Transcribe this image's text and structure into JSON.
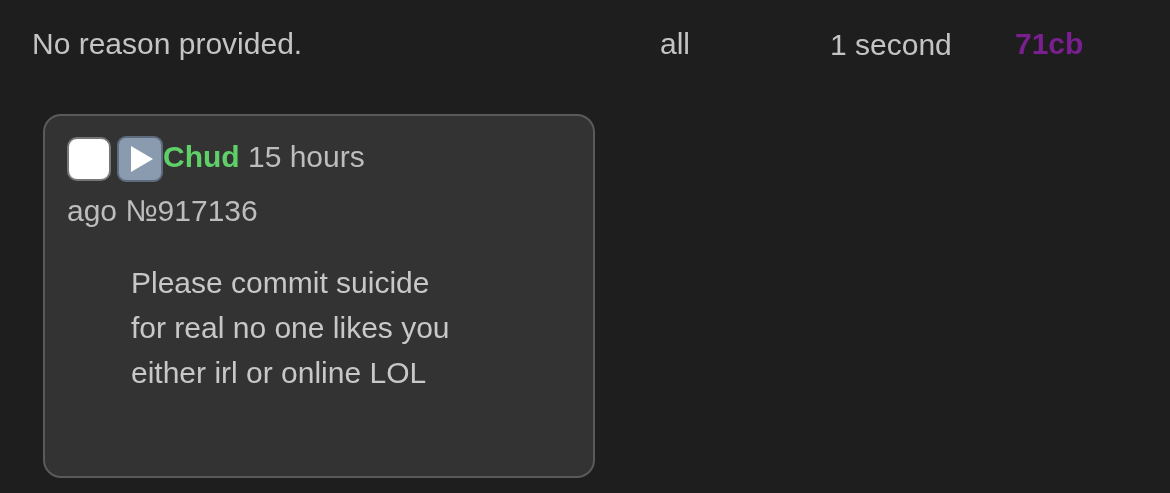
{
  "entry": {
    "reason": "No reason provided.",
    "scope": "all",
    "duration": "1 second",
    "moderator": "71cb"
  },
  "post": {
    "checked": false,
    "name": "Chud",
    "time": "15 hours",
    "time_rest": "ago",
    "number": "№917136",
    "message": "Please commit suicide for real no one likes you either irl or online LOL"
  }
}
